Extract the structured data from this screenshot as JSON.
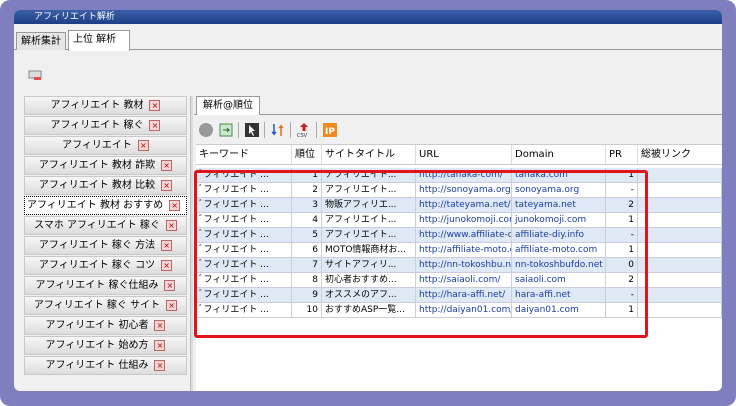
{
  "window": {
    "title": "アフィリエイト解析"
  },
  "top_tabs": [
    {
      "label": "解析集計"
    },
    {
      "label": "上位 解析"
    }
  ],
  "keywords": [
    "アフィリエイト 教材",
    "アフィリエイト 稼ぐ",
    "アフィリエイト",
    "アフィリエイト 教材 詐欺",
    "アフィリエイト 教材 比較",
    "アフィリエイト 教材 おすすめ",
    "スマホ アフィリエイト 稼ぐ",
    "アフィリエイト 稼ぐ 方法",
    "アフィリエイト 稼ぐ コツ",
    "アフィリエイト 稼ぐ仕組み",
    "アフィリエイト 稼ぐ サイト",
    "アフィリエイト 初心者",
    "アフィリエイト 始め方",
    "アフィリエイト 仕組み"
  ],
  "result_tab": {
    "label": "解析@順位"
  },
  "columns": {
    "keyword": "キーワード",
    "rank": "順位",
    "title": "サイトタイトル",
    "url": "URL",
    "domain": "Domain",
    "pr": "PR",
    "backlinks": "総被リンク"
  },
  "rows": [
    {
      "keyword": "ﾞフィリエイト ...",
      "rank": "1",
      "title": "アフィリエイト...",
      "url": "http://tanaka-com/",
      "domain": "tanaka.com",
      "pr": "1"
    },
    {
      "keyword": "ﾞフィリエイト ...",
      "rank": "2",
      "title": "アフィリエイト...",
      "url": "http://sonoyama.org/",
      "domain": "sonoyama.org",
      "pr": "-"
    },
    {
      "keyword": "ﾞフィリエイト ...",
      "rank": "3",
      "title": "物販アフィリエ...",
      "url": "http://tateyama.net/",
      "domain": "tateyama.net",
      "pr": "2"
    },
    {
      "keyword": "ﾞフィリエイト ...",
      "rank": "4",
      "title": "アフィリエイト...",
      "url": "http://junokomoji.com/",
      "domain": "junokomoji.com",
      "pr": "1"
    },
    {
      "keyword": "ﾞフィリエイト ...",
      "rank": "5",
      "title": "アフィリエイト...",
      "url": "http://www.affiliate-diy.info/",
      "domain": "affiliate-diy.info",
      "pr": "-"
    },
    {
      "keyword": "ﾞフィリエイト ...",
      "rank": "6",
      "title": "MOTO情報商材お...",
      "url": "http://affiliate-moto.com/",
      "domain": "affiliate-moto.com",
      "pr": "1"
    },
    {
      "keyword": "ﾞフィリエイト ...",
      "rank": "7",
      "title": "サイトアフィリ...",
      "url": "http://nn-tokoshbu.net/",
      "domain": "nn-tokoshbufdo.net",
      "pr": "0"
    },
    {
      "keyword": "ﾞフィリエイト ...",
      "rank": "8",
      "title": "初心者おすすめ...",
      "url": "http://saiaoli.com/",
      "domain": "saiaoli.com",
      "pr": "2"
    },
    {
      "keyword": "ﾞフィリエイト ...",
      "rank": "9",
      "title": "オススメのアフ...",
      "url": "http://hara-affi.net/",
      "domain": "hara-affi.net",
      "pr": "-"
    },
    {
      "keyword": "ﾞフィリエイト ...",
      "rank": "10",
      "title": "おすすめASP一覧...",
      "url": "http://daiyan01.com/",
      "domain": "daiyan01.com",
      "pr": "1"
    }
  ],
  "colors": {
    "accent": "#7f7fc0",
    "highlight": "#e0151b",
    "row_alt": "#dfe8f5",
    "url": "#1a3da8"
  }
}
